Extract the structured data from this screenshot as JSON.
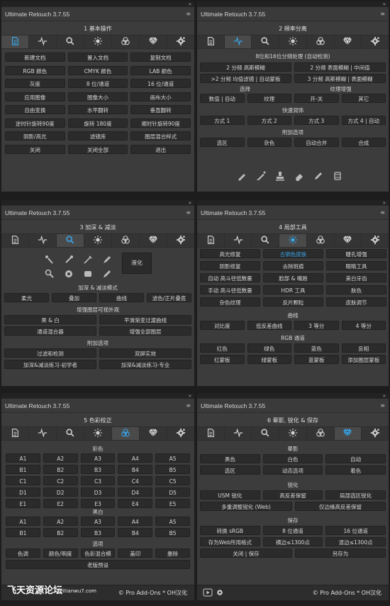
{
  "app_title": "Ultimate Retouch 3.7.55",
  "footer": {
    "copyright": "© Pro Add-Ons * OH汉化",
    "watermark": "飞天资源论坛",
    "watermark_url": "feitianwu7.com"
  },
  "p1": {
    "section": "1 基本操作",
    "buttons": [
      [
        "新建文档",
        "置入文档",
        "复制文档"
      ],
      [
        "RGB 颜色",
        "CMYK 颜色",
        "LAB 颜色"
      ],
      [
        "灰度",
        "8 位/通道",
        "16 位/通道"
      ],
      [
        "应用图像",
        "图像大小",
        "画布大小"
      ],
      [
        "自由变换",
        "水平翻转",
        "垂直翻转"
      ],
      [
        "逆时针旋转90度",
        "旋转 180度",
        "顺时针旋转90度"
      ],
      [
        "阴影/高光",
        "滤镜库",
        "图层混合样式"
      ],
      [
        "关闭",
        "关闭全部",
        "退出"
      ]
    ]
  },
  "p2": {
    "section": "2 频率分离",
    "sub1": "8位和16位分频处理 (自动检测)",
    "r1": [
      "2 分频 高斯模糊",
      "2 分频 表面模糊 | 中间值"
    ],
    "r2": [
      ">2 分频 均值滤镜 | 自动蒙板",
      "3 分频 高斯模糊 | 表面模糊"
    ],
    "lbl_select": "选择",
    "lbl_texture": "纹理增强",
    "r3": [
      "数值 | 自动",
      "纹理",
      "开-关",
      "其它"
    ],
    "lbl_quick": "快速润饰",
    "r4": [
      "方式 1",
      "方式 2",
      "方式 3",
      "方式 4 | 自动"
    ],
    "lbl_extra": "附加选项",
    "r5": [
      "选区",
      "杂色",
      "自动合并",
      "合成"
    ]
  },
  "p3": {
    "section": "3 加深 & 减淡",
    "liquify": "液化",
    "lbl_mode": "加深 & 减淡模式",
    "r1": [
      "柔光",
      "叠加",
      "曲线",
      "滤色/正片叠底"
    ],
    "lbl_helper": "增强图层可视外观",
    "r2": [
      "黑 & 白",
      "平滑渐变过渡曲线"
    ],
    "r3": [
      "通道混合器",
      "增强全部图层"
    ],
    "lbl_extra": "附加选项",
    "r4": [
      "过滤和检测",
      "双屏实效"
    ],
    "r5": [
      "加深&减淡练习-初学者",
      "加深&减淡练习-专业"
    ]
  },
  "p4": {
    "section": "4 局部工具",
    "grid": [
      [
        "高光修复",
        "古铜色皮肤",
        "睫孔增强"
      ],
      [
        "阴影修复",
        "去除斑痕",
        "眼睛工具"
      ],
      [
        "自动 高斗径低数量",
        "脸部 & 嘴唇",
        "美白牙齿"
      ],
      [
        "手动 高斗径低数量",
        "HDR 工具",
        "肤色"
      ],
      [
        "杂色纹理",
        "反片颗粒",
        "皮肤调节"
      ]
    ],
    "lbl_curve": "曲线",
    "r_curve": [
      "对比度",
      "低反差曲线",
      "3 等分",
      "4 等分"
    ],
    "lbl_rgb": "RGB 通道",
    "r_rgb1": [
      "红色",
      "绿色",
      "蓝色",
      "反相"
    ],
    "r_rgb2": [
      "红蒙板",
      "绿蒙板",
      "蓝蒙板",
      "添加图层蒙板"
    ]
  },
  "p5": {
    "section": "5 色彩校正",
    "lbl_color": "彩色",
    "color_rows": [
      [
        "A1",
        "A2",
        "A3",
        "A4",
        "A5"
      ],
      [
        "B1",
        "B2",
        "B3",
        "B4",
        "B5"
      ],
      [
        "C1",
        "C2",
        "C3",
        "C4",
        "C5"
      ],
      [
        "D1",
        "D2",
        "D3",
        "D4",
        "D5"
      ],
      [
        "E1",
        "E2",
        "E3",
        "E4",
        "E5"
      ]
    ],
    "lbl_bw": "黑白",
    "bw_rows": [
      [
        "A1",
        "A2",
        "A3",
        "A4",
        "A5"
      ],
      [
        "B1",
        "B2",
        "B3",
        "B4",
        "B5"
      ]
    ],
    "lbl_opt": "选项",
    "opt": [
      "色调",
      "颜色/明度",
      "色彩混合模",
      "盖印",
      "删除"
    ],
    "preset": "老版预设"
  },
  "p6": {
    "section": "6 晕影, 锐化 & 保存",
    "lbl_vig": "晕影",
    "r1": [
      "黑色",
      "白色",
      "自动"
    ],
    "r2": [
      "选区",
      "动态选项",
      "着色"
    ],
    "lbl_sharp": "锐化",
    "r3": [
      "USM 锐化",
      "高反差保留",
      "局部选区锐化"
    ],
    "r4": [
      "多重调整锐化 (Web)",
      "仅边缘高反差保留"
    ],
    "lbl_save": "保存",
    "r5": [
      "转换 sRGB",
      "8 位通道",
      "16 位通道"
    ],
    "r6": [
      "存为Web所用格式",
      "横边≤1300点",
      "竖边≤1300点"
    ],
    "r7": [
      "关闭 | 保存",
      "另存为"
    ]
  },
  "colors": {
    "accent": "#37a5e8",
    "panel": "#3c3c3c",
    "button": "#2b2b2b"
  }
}
